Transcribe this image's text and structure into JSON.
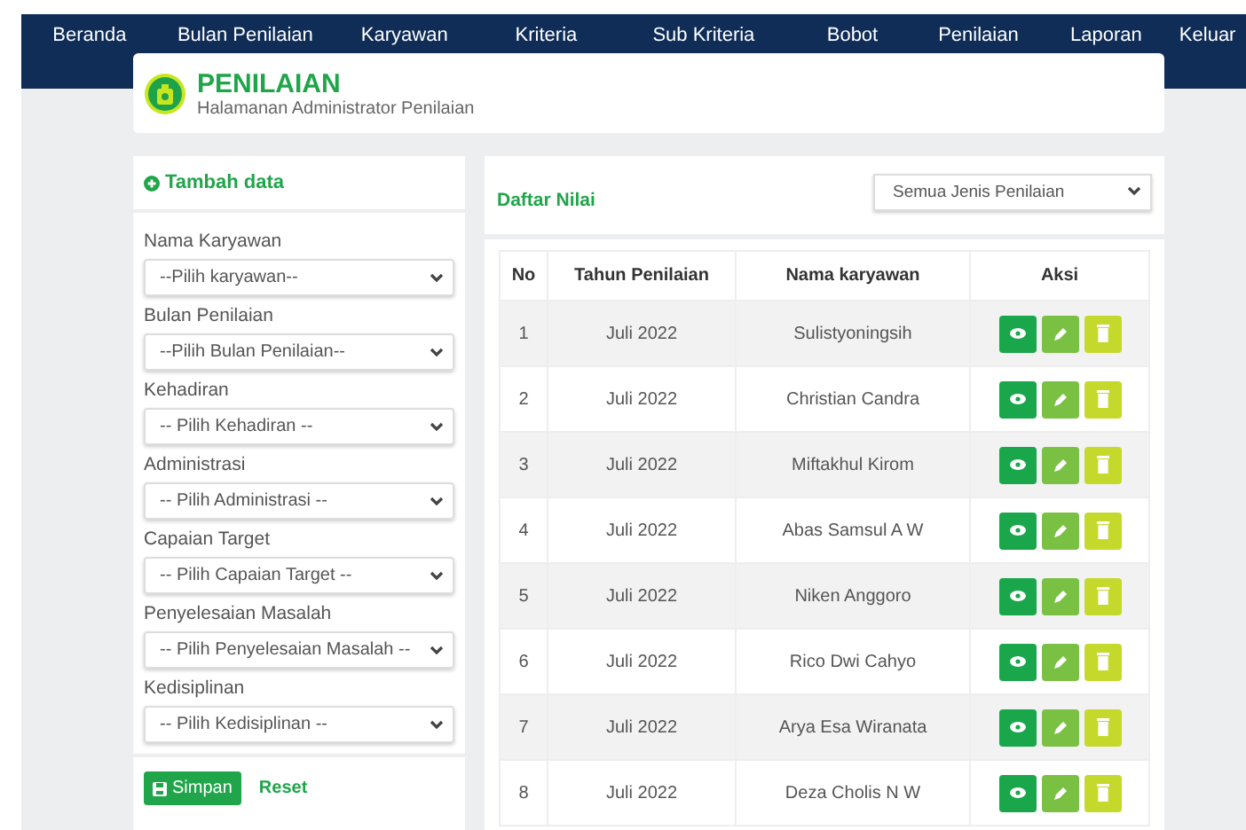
{
  "nav": {
    "items": [
      "Beranda",
      "Bulan Penilaian",
      "Karyawan",
      "Kriteria",
      "Sub Kriteria",
      "Bobot",
      "Penilaian",
      "Laporan",
      "Keluar"
    ]
  },
  "header": {
    "title": "PENILAIAN",
    "subtitle": "Halamanan Administrator Penilaian"
  },
  "form": {
    "title": "Tambah data",
    "fields": [
      {
        "label": "Nama Karyawan",
        "value": "--Pilih karyawan--"
      },
      {
        "label": "Bulan Penilaian",
        "value": "--Pilih Bulan Penilaian--"
      },
      {
        "label": "Kehadiran",
        "value": "-- Pilih Kehadiran --"
      },
      {
        "label": "Administrasi",
        "value": "-- Pilih Administrasi --"
      },
      {
        "label": "Capaian Target",
        "value": "-- Pilih Capaian Target --"
      },
      {
        "label": "Penyelesaian Masalah",
        "value": "-- Pilih Penyelesaian Masalah --"
      },
      {
        "label": "Kedisiplinan",
        "value": "-- Pilih Kedisiplinan --"
      }
    ],
    "buttons": [
      {
        "label": "Simpan",
        "kind": "primary"
      },
      {
        "label": "Reset",
        "kind": "link"
      }
    ]
  },
  "list": {
    "title": "Daftar Nilai",
    "filter": "Semua Jenis Penilaian",
    "table": {
      "columns": [
        "No",
        "Tahun Penilaian",
        "Nama karyawan",
        "Aksi"
      ],
      "rows": [
        {
          "no": "1",
          "tahun": "Juli 2022",
          "nama": "Sulistyoningsih"
        },
        {
          "no": "2",
          "tahun": "Juli 2022",
          "nama": "Christian Candra"
        },
        {
          "no": "3",
          "tahun": "Juli 2022",
          "nama": "Miftakhul Kirom"
        },
        {
          "no": "4",
          "tahun": "Juli 2022",
          "nama": "Abas Samsul A W"
        },
        {
          "no": "5",
          "tahun": "Juli 2022",
          "nama": "Niken Anggoro"
        },
        {
          "no": "6",
          "tahun": "Juli 2022",
          "nama": "Rico Dwi Cahyo"
        },
        {
          "no": "7",
          "tahun": "Juli 2022",
          "nama": "Arya Esa Wiranata"
        },
        {
          "no": "8",
          "tahun": "Juli 2022",
          "nama": "Deza Cholis N W"
        }
      ]
    }
  }
}
